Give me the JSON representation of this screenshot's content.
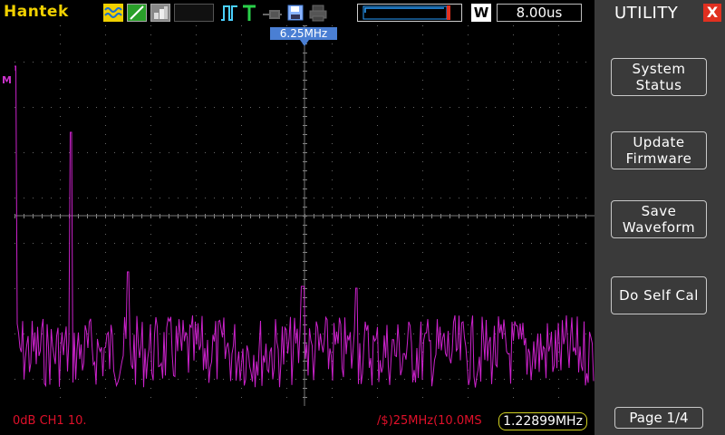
{
  "header": {
    "brand": "Hantek",
    "timebase": "8.00us",
    "window_mode": "W",
    "icons": [
      "mode-waveform-icon",
      "mode-line-icon",
      "mode-dots-icon",
      "trigger-edge-icon",
      "trigger-t-icon",
      "probe-icon",
      "save-disk-icon",
      "print-icon",
      "memory-waveform-icon"
    ]
  },
  "screen": {
    "center_frequency": "6.25MHz",
    "marker_label": "M",
    "trace_color": "#cc22cc"
  },
  "status": {
    "left": "0dB  CH1 10.",
    "middle": "/$)25MHz(10.0MS",
    "frequency": "1.22899MHz"
  },
  "panel": {
    "title": "UTILITY",
    "close": "X",
    "buttons": [
      {
        "line1": "System",
        "line2": "Status"
      },
      {
        "line1": "Update",
        "line2": "Firmware"
      },
      {
        "line1": "Save",
        "line2": "Waveform"
      },
      {
        "line1": "Do Self Cal",
        "line2": ""
      }
    ],
    "page": "Page 1/4"
  },
  "colors": {
    "accent": "#f0d000",
    "panel_bg": "#3a3a3a",
    "marker": "#4a7fd4",
    "status_red": "#e0102a",
    "close_red": "#e03020"
  }
}
